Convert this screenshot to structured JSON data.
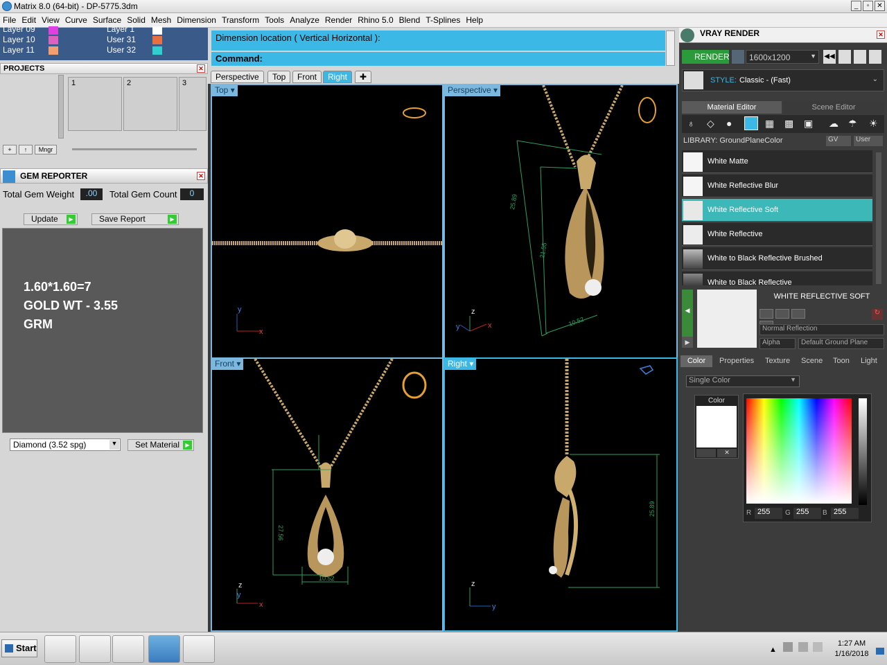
{
  "window": {
    "title": "Matrix 8.0 (64-bit) - DP-5775.3dm"
  },
  "menu": [
    "File",
    "Edit",
    "View",
    "Curve",
    "Surface",
    "Solid",
    "Mesh",
    "Dimension",
    "Transform",
    "Tools",
    "Analyze",
    "Render",
    "Rhino 5.0",
    "Blend",
    "T-Splines",
    "Help"
  ],
  "layers": {
    "left": [
      {
        "name": "Layer 09",
        "color": "#e040e0"
      },
      {
        "name": "Layer 10",
        "color": "#e060c0"
      },
      {
        "name": "Layer 11",
        "color": "#f0a070"
      }
    ],
    "right": [
      {
        "name": "Layer 1",
        "color": "#ffffff"
      },
      {
        "name": "User 31",
        "color": "#e87040"
      },
      {
        "name": "User 32",
        "color": "#30d0d0"
      }
    ]
  },
  "projects": {
    "title": "PROJECTS",
    "cells": [
      "1",
      "2",
      "3"
    ],
    "mngr": "Mngr"
  },
  "gem_reporter": {
    "title": "GEM REPORTER",
    "weight_label": "Total Gem Weight",
    "weight_value": ".00",
    "count_label": "Total Gem Count",
    "count_value": "0",
    "update": "Update",
    "save": "Save Report",
    "notes": [
      "1.60*1.60=7",
      "GOLD WT - 3.55",
      "GRM"
    ],
    "material": "Diamond     (3.52 spg)",
    "set_material": "Set Material"
  },
  "command": {
    "prompt": "Dimension location ( Vertical  Horizontal ):",
    "label": "Command:"
  },
  "view_tabs": [
    "Perspective",
    "Top",
    "Front",
    "Right"
  ],
  "active_tab": "Right",
  "viewports": {
    "top": {
      "label": "Top",
      "axis_y": "y",
      "axis_x": "x"
    },
    "perspective": {
      "label": "Perspective",
      "dim1": "25.89",
      "dim2": "21.55",
      "dim3": "10.52",
      "axis_z": "z",
      "axis_y": "y",
      "axis_x": "x"
    },
    "front": {
      "label": "Front",
      "dim1": "27.56",
      "dim2": "10.52",
      "axis_z": "z",
      "axis_y": "y",
      "axis_x": "x"
    },
    "right": {
      "label": "Right",
      "dim1": "25.89",
      "axis_z": "z",
      "axis_y": "y"
    }
  },
  "vray": {
    "title": "VRAY RENDER",
    "render": "RENDER",
    "resolution": "1600x1200",
    "style_label": "STYLE:",
    "style_value": "Classic - (Fast)",
    "tabs": [
      "Material Editor",
      "Scene Editor"
    ],
    "library": "LIBRARY: GroundPlaneColor",
    "gv": "GV",
    "user": "User",
    "materials": [
      "White Matte",
      "White Reflective Blur",
      "White Reflective Soft",
      "White Reflective",
      "White to Black Reflective Brushed",
      "White to Black Reflective"
    ],
    "selected": "White Reflective Soft",
    "preview_title": "WHITE REFLECTIVE SOFT",
    "reflection": "Normal Reflection",
    "alpha": "Alpha",
    "ground": "Default Ground Plane",
    "prop_tabs": [
      "Color",
      "Properties",
      "Texture",
      "Scene",
      "Toon",
      "Light"
    ],
    "color_mode": "Single Color",
    "color_label": "Color",
    "r_label": "R",
    "r": "255",
    "g_label": "G",
    "g": "255",
    "b_label": "B",
    "b": "255"
  },
  "taskbar": {
    "start": "Start",
    "time": "1:27 AM",
    "date": "1/16/2018"
  }
}
